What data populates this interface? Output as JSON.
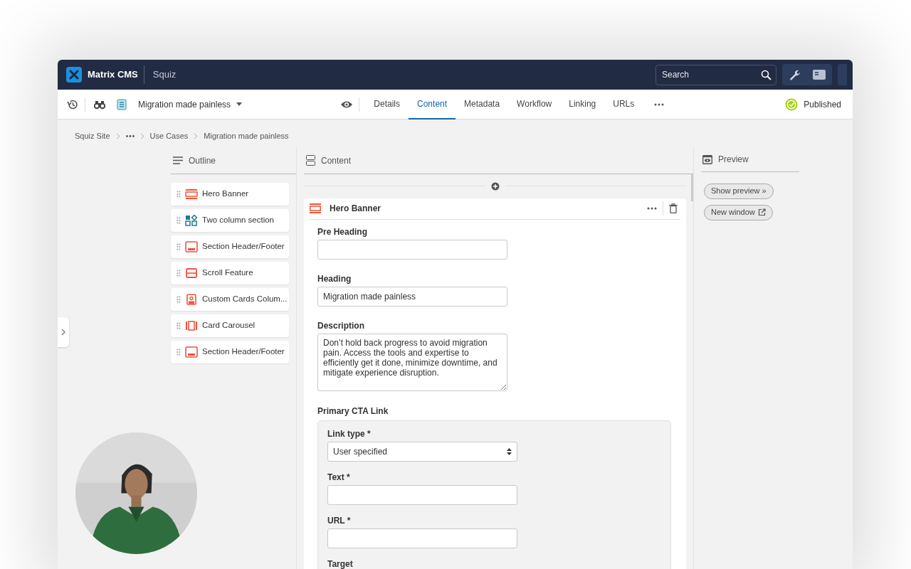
{
  "app": {
    "name": "Matrix CMS",
    "site": "Squiz"
  },
  "search": {
    "placeholder": "Search"
  },
  "toolbar": {
    "asset_title": "Migration made painless",
    "status": "Published",
    "tabs": [
      {
        "label": "Details",
        "selected": false
      },
      {
        "label": "Content",
        "selected": true
      },
      {
        "label": "Metadata",
        "selected": false
      },
      {
        "label": "Workflow",
        "selected": false
      },
      {
        "label": "Linking",
        "selected": false
      },
      {
        "label": "URLs",
        "selected": false
      }
    ]
  },
  "breadcrumb": [
    "Squiz Site",
    "Use Cases",
    "Migration made painless"
  ],
  "outline": {
    "title": "Outline",
    "items": [
      {
        "label": "Hero Banner",
        "kind": "banner",
        "color": "#f0533a"
      },
      {
        "label": "Two column section",
        "kind": "columns",
        "color": "#1f7a8c"
      },
      {
        "label": "Section Header/Footer",
        "kind": "section",
        "color": "#f0533a"
      },
      {
        "label": "Scroll Feature",
        "kind": "scroll",
        "color": "#f0533a"
      },
      {
        "label": "Custom Cards Colum...",
        "kind": "cards",
        "color": "#f0533a"
      },
      {
        "label": "Card Carousel",
        "kind": "carousel",
        "color": "#f0533a"
      },
      {
        "label": "Section Header/Footer",
        "kind": "section",
        "color": "#f0533a"
      }
    ]
  },
  "content": {
    "title": "Content",
    "block": {
      "title": "Hero Banner",
      "fields": [
        {
          "label": "Pre Heading",
          "kind": "input"
        },
        {
          "label": "Heading",
          "kind": "input",
          "value": "Migration made painless"
        },
        {
          "label": "Description",
          "kind": "textarea",
          "value": "Don’t hold back progress to avoid migration pain. Access the tools and expertise to efficiently get it done, minimize downtime, and mitigate experience disruption."
        }
      ],
      "group": {
        "title": "Primary CTA Link",
        "fields": [
          {
            "label": "Link type *",
            "kind": "select",
            "value": "User specified"
          },
          {
            "label": "Text *",
            "kind": "input"
          },
          {
            "label": "URL *",
            "kind": "input"
          },
          {
            "label": "Target",
            "kind": "label"
          }
        ]
      }
    }
  },
  "preview": {
    "title": "Preview",
    "buttons": [
      {
        "label": "Show preview »",
        "kind": "show"
      },
      {
        "label": "New window",
        "kind": "external"
      }
    ]
  }
}
